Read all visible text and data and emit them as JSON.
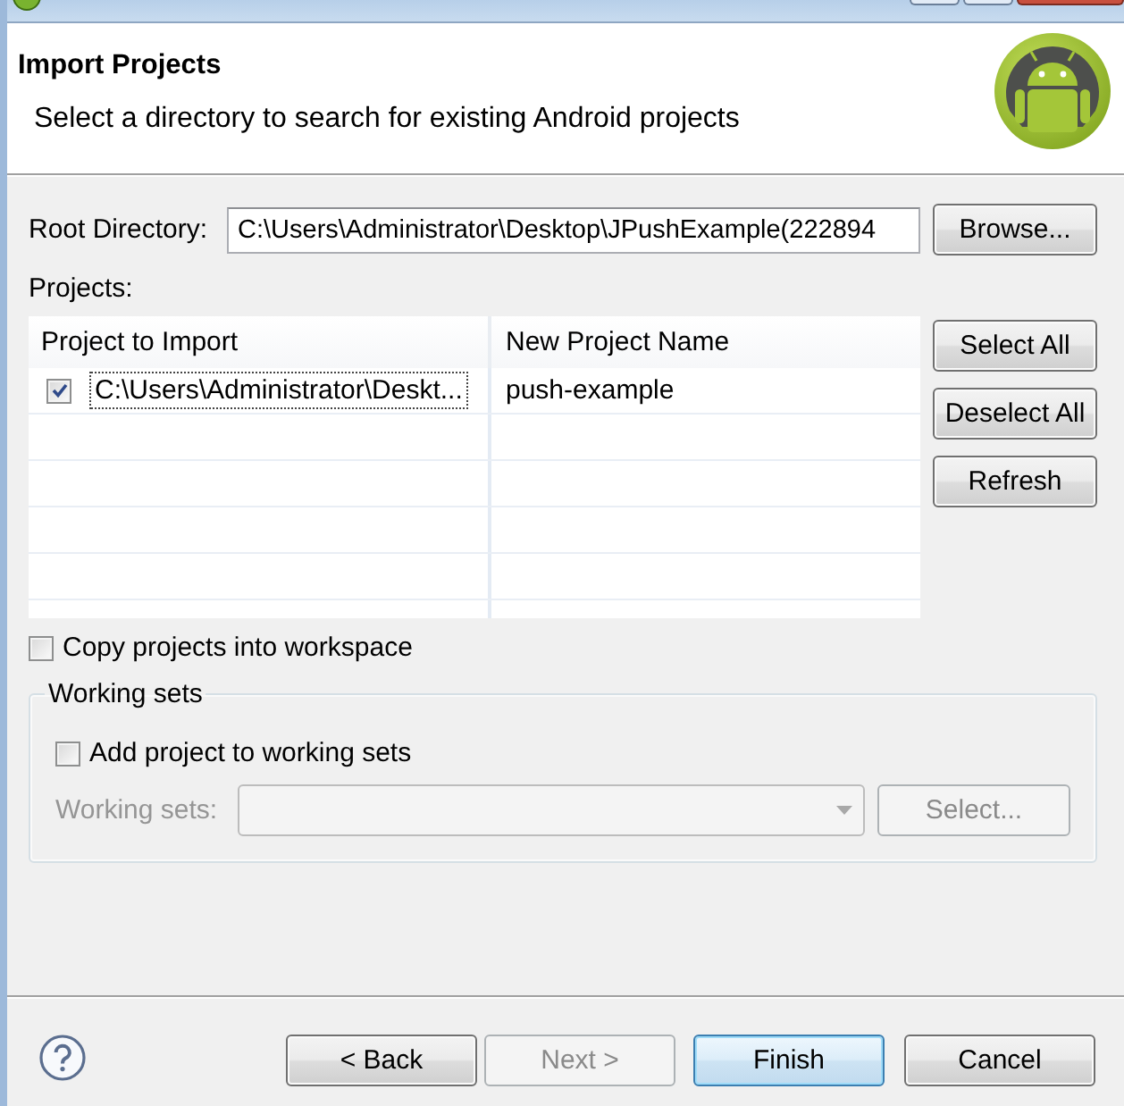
{
  "header": {
    "title": "Import Projects",
    "description": "Select a directory to search for existing Android projects"
  },
  "root_directory": {
    "label": "Root Directory:",
    "value": "C:\\Users\\Administrator\\Desktop\\JPushExample(222894",
    "browse_button": "Browse..."
  },
  "projects": {
    "label": "Projects:",
    "table": {
      "columns": [
        "Project to Import",
        "New Project Name"
      ],
      "rows": [
        {
          "checked": true,
          "focused": true,
          "cells": [
            "C:\\Users\\Administrator\\Deskt...",
            "push-example"
          ]
        }
      ]
    },
    "buttons": [
      {
        "label": "Select All"
      },
      {
        "label": "Deselect All"
      },
      {
        "label": "Refresh"
      }
    ]
  },
  "copy_into_workspace": {
    "label": "Copy projects into workspace",
    "checked": false
  },
  "working_sets": {
    "title": "Working sets",
    "add_checkbox": {
      "label": "Add project to working sets",
      "checked": false
    },
    "field": {
      "label": "Working sets:",
      "disabled": true
    },
    "select_button": {
      "label": "Select...",
      "disabled": true
    }
  },
  "footer": {
    "buttons": [
      {
        "label": "< Back",
        "disabled": false,
        "default": false
      },
      {
        "label": "Next >",
        "disabled": true,
        "default": false
      },
      {
        "label": "Finish",
        "disabled": false,
        "default": true
      },
      {
        "label": "Cancel",
        "disabled": false,
        "default": false
      }
    ]
  }
}
